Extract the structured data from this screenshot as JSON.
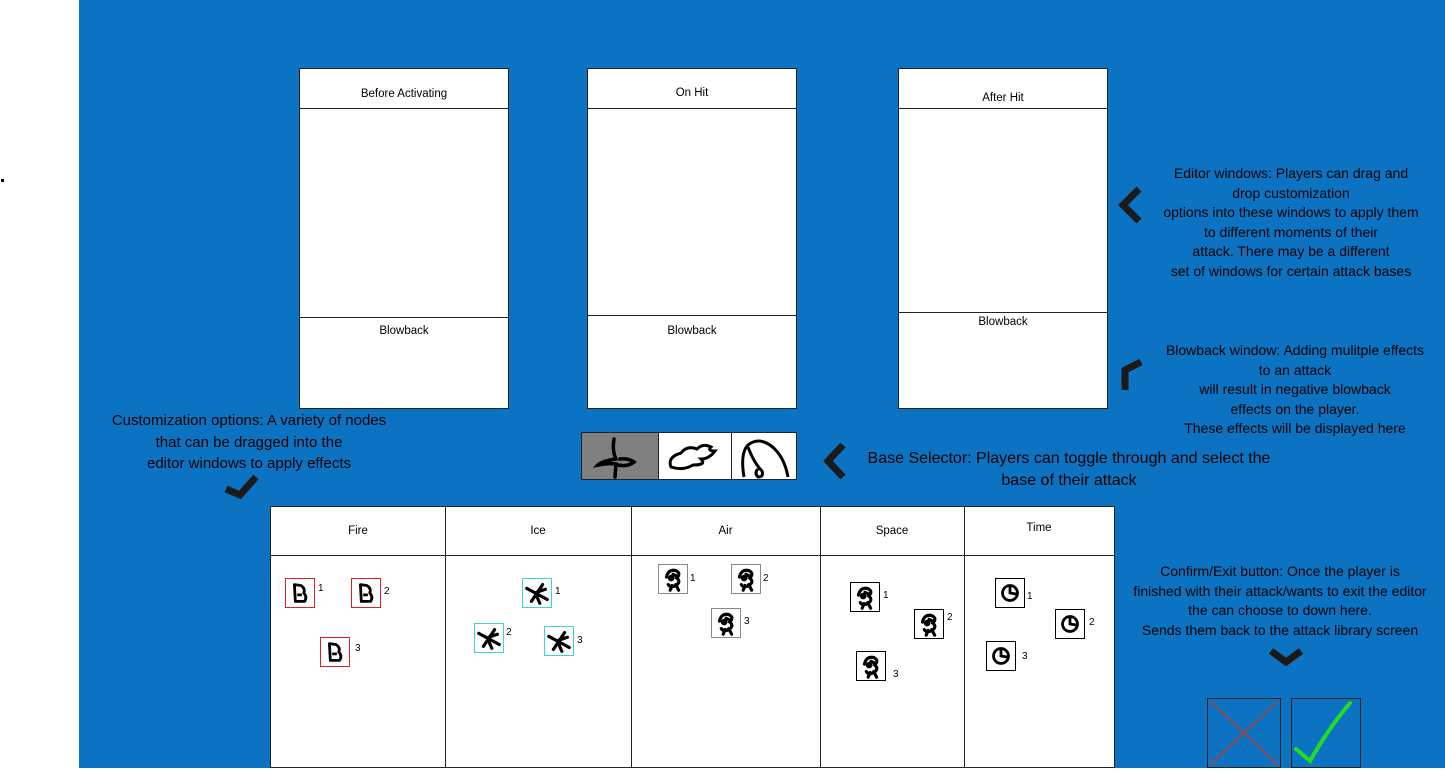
{
  "colors": {
    "canvas": "#0b73c2",
    "fire_border": "#e02020",
    "ice_border": "#3ad5d5",
    "panel_bg": "#ffffff",
    "selected_base": "#808080",
    "confirm_check": "#22dd22",
    "exit_cross": "#c0392b"
  },
  "editor_windows": [
    {
      "title": "Before Activating",
      "blowback": "Blowback"
    },
    {
      "title": "On Hit",
      "blowback": "Blowback"
    },
    {
      "title": "After Hit",
      "blowback": "Blowback"
    }
  ],
  "annotations": {
    "editor": [
      "Editor windows: Players can drag and",
      "drop customization",
      "options into these windows to apply them",
      "to different moments of their",
      "attack. There may be a different",
      "set of windows for certain attack bases"
    ],
    "blowback": [
      "Blowback window: Adding mulitple effects",
      "to an attack",
      "will result in negative blowback",
      "effects on the player.",
      "These effects will be displayed here"
    ],
    "customization": [
      "Customization options: A variety of nodes",
      "that can be dragged into the",
      "editor windows to apply effects"
    ],
    "base_selector": [
      "Base Selector: Players can toggle through and select the",
      "base of their attack"
    ],
    "confirm": [
      "Confirm/Exit button: Once the player is",
      "finished with their attack/wants to exit the editor",
      "the can choose to down here.",
      "Sends them back to the attack library screen"
    ]
  },
  "base_selector": {
    "options": [
      "sword-icon",
      "cloud-icon",
      "whip-icon"
    ],
    "selected": 0
  },
  "categories": [
    {
      "name": "Fire",
      "icon": "fire-rune-icon",
      "nodes": [
        "1",
        "2",
        "3"
      ]
    },
    {
      "name": "Ice",
      "icon": "ice-rune-icon",
      "nodes": [
        "1",
        "2",
        "3"
      ]
    },
    {
      "name": "Air",
      "icon": "air-rune-icon",
      "nodes": [
        "1",
        "2",
        "3"
      ]
    },
    {
      "name": "Space",
      "icon": "space-rune-icon",
      "nodes": [
        "1",
        "2",
        "3"
      ]
    },
    {
      "name": "Time",
      "icon": "clock-rune-icon",
      "nodes": [
        "1",
        "2",
        "3"
      ]
    }
  ],
  "buttons": {
    "exit": "exit-x-icon",
    "confirm": "checkmark-icon"
  }
}
